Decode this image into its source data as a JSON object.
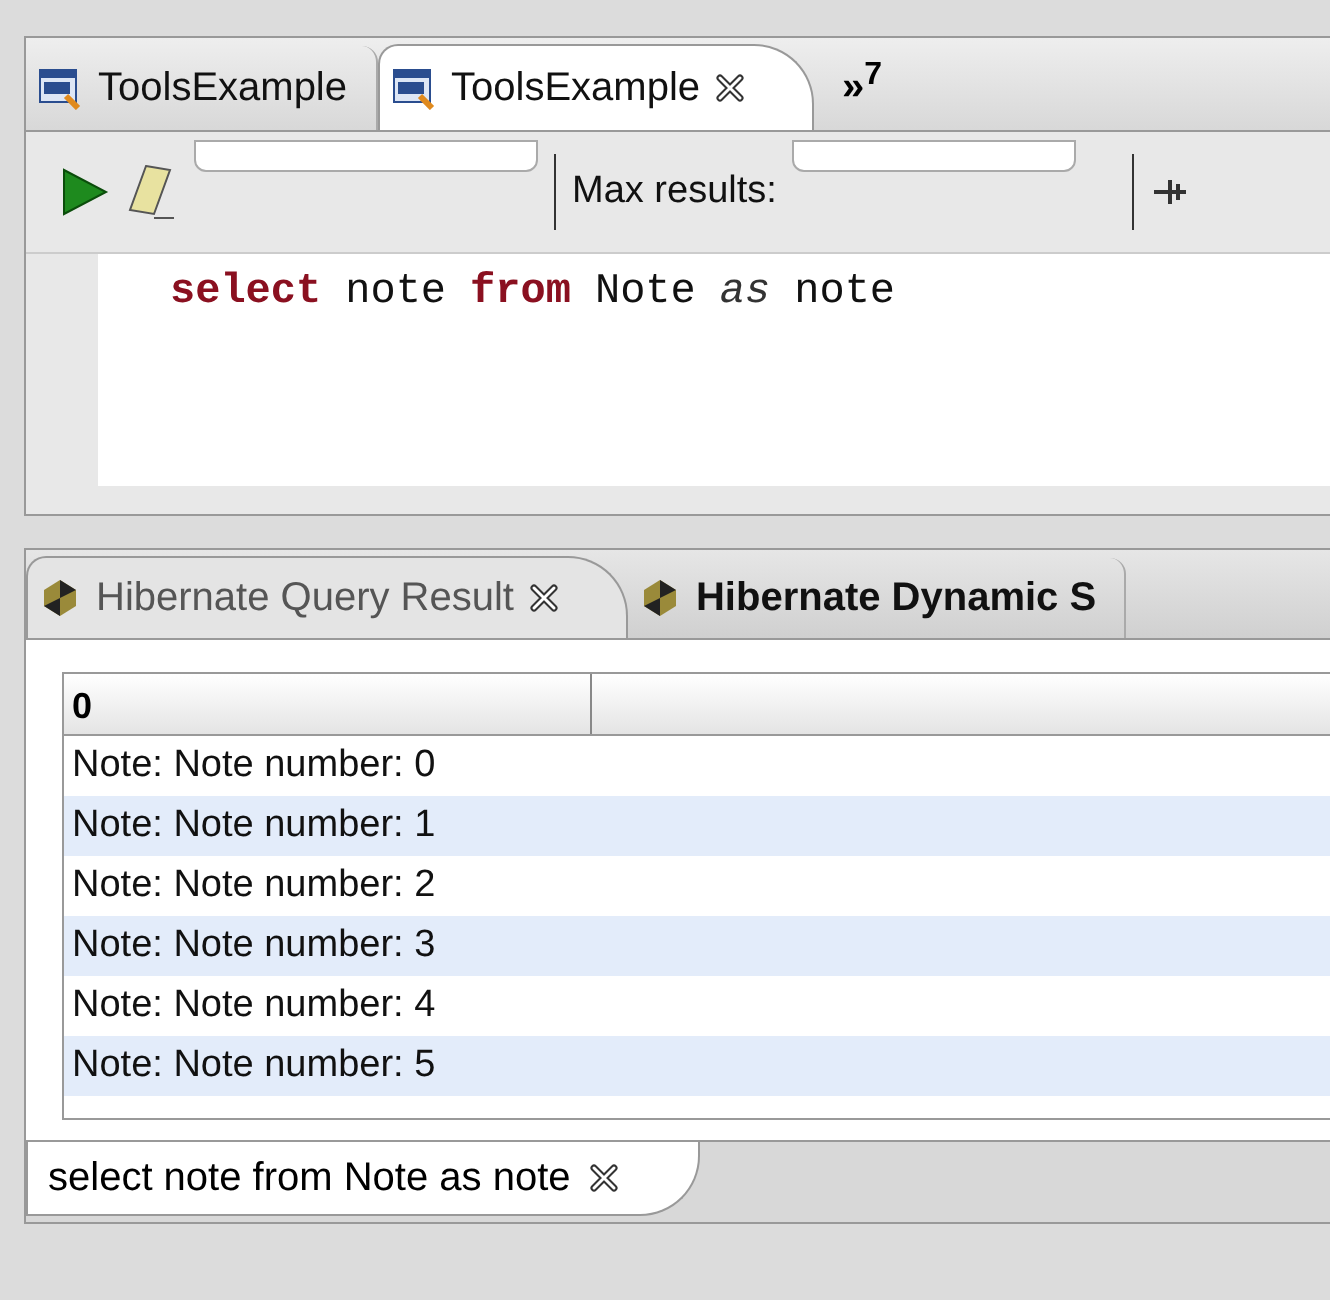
{
  "editor_tabs": [
    {
      "label": "ToolsExample",
      "selected": false,
      "closable": false
    },
    {
      "label": "ToolsExample",
      "selected": true,
      "closable": true
    }
  ],
  "overflow": {
    "label": "»",
    "count": "7"
  },
  "toolbar": {
    "max_results_label": "Max results:"
  },
  "query": [
    {
      "text": "select",
      "kind": "keyword"
    },
    {
      "text": "note",
      "kind": "plain"
    },
    {
      "text": "from",
      "kind": "keyword"
    },
    {
      "text": "Note",
      "kind": "plain"
    },
    {
      "text": "as",
      "kind": "alias"
    },
    {
      "text": "note",
      "kind": "plain"
    }
  ],
  "result_tabs": [
    {
      "label": "Hibernate Query Result",
      "selected": true,
      "closable": true
    },
    {
      "label": "Hibernate Dynamic S",
      "selected": false,
      "closable": false
    }
  ],
  "table": {
    "columns": [
      "0"
    ],
    "rows": [
      "Note: Note number: 0",
      "Note: Note number: 1",
      "Note: Note number: 2",
      "Note: Note number: 3",
      "Note: Note number: 4",
      "Note: Note number: 5"
    ]
  },
  "bottom_tab": {
    "label": "select note from Note as note",
    "selected": true
  }
}
